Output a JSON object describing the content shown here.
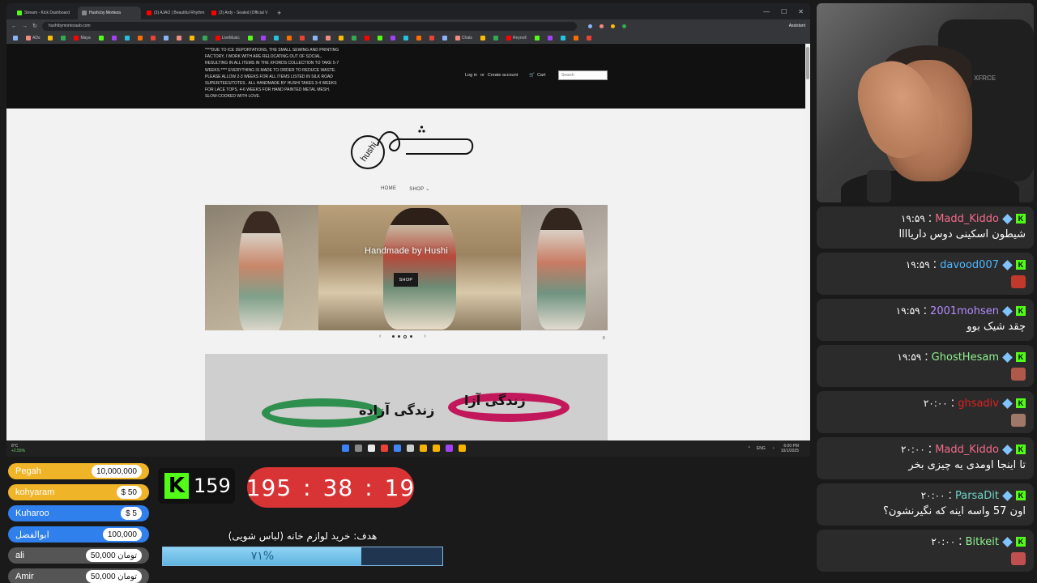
{
  "browser": {
    "tabs": [
      {
        "label": "Stream - Kick Dashboard",
        "color": "#53fc18",
        "active": false
      },
      {
        "label": "Hushi.by Morteza",
        "color": "#888888",
        "active": true
      },
      {
        "label": "(3) AJAO | Beautiful Rhythm",
        "color": "#ff0000",
        "active": false
      },
      {
        "label": "(3) Ardy - Sealed (Official V",
        "color": "#ff0000",
        "active": false
      }
    ],
    "new_tab": "+",
    "url": "hushibymortezaab.com",
    "assistant_label": "Assistant",
    "bookmarks": [
      "ADs",
      "Maya",
      "LiveMusic",
      "Chats",
      "Reynoll"
    ],
    "bookmark_colors": [
      "#8ab4f8",
      "#f28b82",
      "#fbbc04",
      "#34a853",
      "#ff0000",
      "#53fc18",
      "#a142f4",
      "#24c1e0",
      "#ff6d01",
      "#ea4335"
    ]
  },
  "site": {
    "announcement": "****DUE TO ICE DEPORTATIONS, THE SMALL SEWING AND PRINTING FACTORY, I WORK WITH ARE RELOCATING OUT OF SOCIAL, RESULTING IN ALL ITEMS IN THE XFORDS COLLECTION TO TAKE 5-7 WEEKS.**** EVERYTHING IS MADE TO ORDER TO REDUCE WASTE. PLEASE ALLOW 2-3 WEEKS FOR ALL ITEMS LISTED IN SILK ROAD SUPER/TEES/TOTES . ALL HANDMADE BY HUSHI TAKES 3-4 WEEKS FOR LACE TOPS. 4-6 WEEKS FOR HAND PAINTED METAL MESH. SLOW-COOKED WITH LOVE.",
    "login": "Log in",
    "or": "or",
    "create_account": "Create account",
    "cart": "Cart",
    "search_placeholder": "Search",
    "logo_text": "hushi",
    "nav_home": "HOME",
    "nav_shop": "SHOP ⌄",
    "hero_title": "Handmade by Hushi",
    "hero_button": "SHOP",
    "slider_prev": "‹",
    "slider_next": "›",
    "pause": "II",
    "promo_text_1": "زندگی آزاده",
    "promo_text_2": "زندگی آزا"
  },
  "taskbar": {
    "weather_temp": "8°C",
    "weather_change": "+2.55%",
    "lang": "ENG",
    "time": "6:00 PM",
    "date": "10/1/2025",
    "icon_colors": [
      "#3b82f6",
      "#888888",
      "#e8e8e8",
      "#ea4335",
      "#4285f4",
      "#cccccc",
      "#f4b400",
      "#f4b400",
      "#a142f4",
      "#f4b400"
    ]
  },
  "webcam": {
    "chair_text": "XFRCE"
  },
  "chat": [
    {
      "time": "۱۹:۵۹",
      "user": "Madd_Kiddo",
      "user_color": "#f26b8a",
      "text": "شیطون اسکینی دوس داریاااا",
      "emote": false
    },
    {
      "time": "۱۹:۵۹",
      "user": "davood007",
      "user_color": "#4fb8ff",
      "text": "",
      "emote": true,
      "emote_color": "#c0392b"
    },
    {
      "time": "۱۹:۵۹",
      "user": "2001mohsen",
      "user_color": "#b48cff",
      "text": "چقد شیک بوو",
      "emote": false
    },
    {
      "time": "۱۹:۵۹",
      "user": "GhostHesam",
      "user_color": "#8ff08f",
      "text": "",
      "emote": true,
      "emote_color": "#b0584a"
    },
    {
      "time": "۲۰:۰۰",
      "user": "ghsadiv",
      "user_color": "#e02020",
      "text": "",
      "emote": true,
      "emote_color": "#a07868"
    },
    {
      "time": "۲۰:۰۰",
      "user": "Madd_Kiddo",
      "user_color": "#f26b8a",
      "text": "تا اینجا اومدی یه چیزی بخر",
      "emote": false
    },
    {
      "time": "۲۰:۰۰",
      "user": "ParsaDit",
      "user_color": "#6fd3c8",
      "text": "اون 57 واسه اینه که نگیرنشون؟",
      "emote": false
    },
    {
      "time": "۲۰:۰۰",
      "user": "Bitkeit",
      "user_color": "#8ff08f",
      "text": "",
      "emote": true,
      "emote_color": "#c05050"
    }
  ],
  "donations": [
    {
      "name": "Pegah",
      "value": "10,000,000",
      "color": "#f0b429"
    },
    {
      "name": "kohyaram",
      "value": "$ 50",
      "color": "#f0b429"
    },
    {
      "name": "Kuharoo",
      "value": "$ 5",
      "color": "#2f80ed"
    },
    {
      "name": "ابوالفضل",
      "value": "100,000",
      "color": "#2f80ed"
    },
    {
      "name": "ali",
      "value": "50,000 تومان",
      "color": "#555555"
    },
    {
      "name": "Amir",
      "value": "50,000 تومان",
      "color": "#555555"
    }
  ],
  "kick": {
    "logo": "K",
    "count": "159"
  },
  "timer": {
    "hours": "195",
    "minutes": "38",
    "seconds": "19",
    "sep": ":"
  },
  "goal": {
    "label": "هدف: خرید لوازم خانه (لباس شویی)",
    "percent_text": "۷۱%",
    "fraction": 0.71
  }
}
